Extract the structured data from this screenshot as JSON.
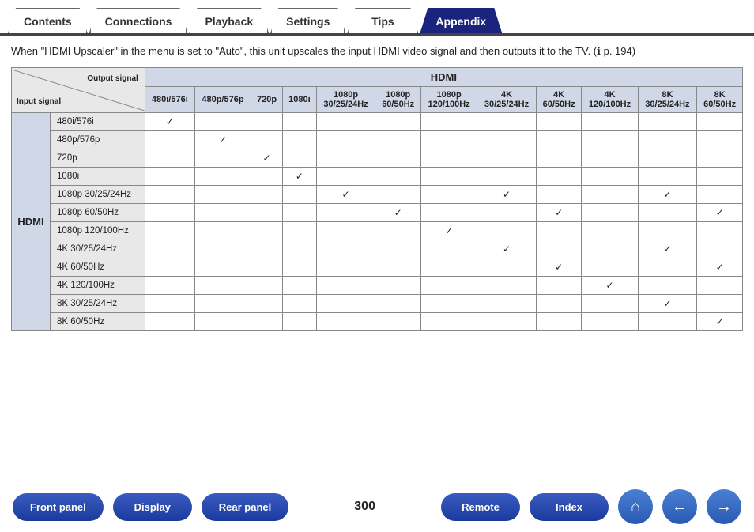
{
  "tabs": [
    {
      "id": "contents",
      "label": "Contents",
      "active": false
    },
    {
      "id": "connections",
      "label": "Connections",
      "active": false
    },
    {
      "id": "playback",
      "label": "Playback",
      "active": false
    },
    {
      "id": "settings",
      "label": "Settings",
      "active": false
    },
    {
      "id": "tips",
      "label": "Tips",
      "active": false
    },
    {
      "id": "appendix",
      "label": "Appendix",
      "active": true
    }
  ],
  "intro": {
    "text": "When \"HDMI Upscaler\" in the menu is set to \"Auto\", this unit upscales the input HDMI video signal and then outputs it to the TV. (",
    "ref": "p. 194)"
  },
  "table": {
    "output_label": "Output signal",
    "input_label": "Input signal",
    "hdmi_label": "HDMI",
    "columns": [
      "480i/576i",
      "480p/576p",
      "720p",
      "1080i",
      "1080p\n30/25/24Hz",
      "1080p\n60/50Hz",
      "1080p\n120/100Hz",
      "4K\n30/25/24Hz",
      "4K\n60/50Hz",
      "4K\n120/100Hz",
      "8K\n30/25/24Hz",
      "8K\n60/50Hz"
    ],
    "columns_display": [
      "480i/576i",
      "480p/576p",
      "720p",
      "1080i",
      "1080p<br>30/25/24Hz",
      "1080p<br>60/50Hz",
      "1080p<br>120/100Hz",
      "4K<br>30/25/24Hz",
      "4K<br>60/50Hz",
      "4K<br>120/100Hz",
      "8K<br>30/25/24Hz",
      "8K<br>60/50Hz"
    ],
    "row_group_label": "HDMI",
    "rows": [
      {
        "label": "480i/576i",
        "checks": [
          true,
          false,
          false,
          false,
          false,
          false,
          false,
          false,
          false,
          false,
          false,
          false
        ]
      },
      {
        "label": "480p/576p",
        "checks": [
          false,
          true,
          false,
          false,
          false,
          false,
          false,
          false,
          false,
          false,
          false,
          false
        ]
      },
      {
        "label": "720p",
        "checks": [
          false,
          false,
          true,
          false,
          false,
          false,
          false,
          false,
          false,
          false,
          false,
          false
        ]
      },
      {
        "label": "1080i",
        "checks": [
          false,
          false,
          false,
          true,
          false,
          false,
          false,
          false,
          false,
          false,
          false,
          false
        ]
      },
      {
        "label": "1080p 30/25/24Hz",
        "checks": [
          false,
          false,
          false,
          false,
          true,
          false,
          false,
          true,
          false,
          false,
          true,
          false
        ]
      },
      {
        "label": "1080p 60/50Hz",
        "checks": [
          false,
          false,
          false,
          false,
          false,
          true,
          false,
          false,
          true,
          false,
          false,
          true
        ]
      },
      {
        "label": "1080p 120/100Hz",
        "checks": [
          false,
          false,
          false,
          false,
          false,
          false,
          true,
          false,
          false,
          false,
          false,
          false
        ]
      },
      {
        "label": "4K 30/25/24Hz",
        "checks": [
          false,
          false,
          false,
          false,
          false,
          false,
          false,
          true,
          false,
          false,
          true,
          false
        ]
      },
      {
        "label": "4K 60/50Hz",
        "checks": [
          false,
          false,
          false,
          false,
          false,
          false,
          false,
          false,
          true,
          false,
          false,
          true
        ]
      },
      {
        "label": "4K 120/100Hz",
        "checks": [
          false,
          false,
          false,
          false,
          false,
          false,
          false,
          false,
          false,
          true,
          false,
          false
        ]
      },
      {
        "label": "8K 30/25/24Hz",
        "checks": [
          false,
          false,
          false,
          false,
          false,
          false,
          false,
          false,
          false,
          false,
          true,
          false
        ]
      },
      {
        "label": "8K 60/50Hz",
        "checks": [
          false,
          false,
          false,
          false,
          false,
          false,
          false,
          false,
          false,
          false,
          false,
          true
        ]
      }
    ]
  },
  "bottom_nav": {
    "page_number": "300",
    "buttons": {
      "front_panel": "Front panel",
      "display": "Display",
      "rear_panel": "Rear panel",
      "remote": "Remote",
      "index": "Index"
    }
  }
}
